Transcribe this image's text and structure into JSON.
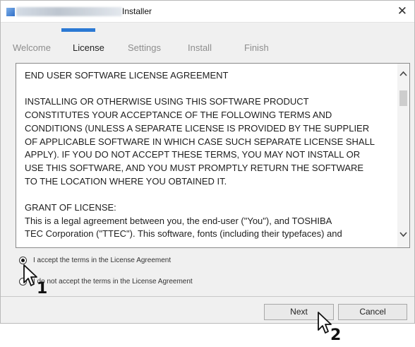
{
  "window": {
    "title": "Installer",
    "close_glyph": "✕"
  },
  "tabs": [
    {
      "label": "Welcome",
      "active": false
    },
    {
      "label": "License",
      "active": true
    },
    {
      "label": "Settings",
      "active": false
    },
    {
      "label": "Install",
      "active": false
    },
    {
      "label": "Finish",
      "active": false
    }
  ],
  "license": {
    "heading": "END USER SOFTWARE LICENSE AGREEMENT",
    "paragraph1": "INSTALLING OR OTHERWISE USING THIS SOFTWARE PRODUCT\nCONSTITUTES YOUR ACCEPTANCE OF THE FOLLOWING TERMS AND\nCONDITIONS (UNLESS A SEPARATE LICENSE IS PROVIDED BY THE SUPPLIER\nOF APPLICABLE SOFTWARE IN WHICH CASE SUCH SEPARATE LICENSE SHALL\nAPPLY). IF YOU DO NOT ACCEPT THESE TERMS, YOU MAY NOT INSTALL OR\nUSE THIS SOFTWARE, AND YOU MUST PROMPTLY RETURN THE SOFTWARE\nTO THE LOCATION WHERE YOU OBTAINED IT.",
    "grant_heading": "GRANT OF LICENSE:",
    "grant_text": "This is a legal agreement between you, the end-user (\"You\"), and TOSHIBA\nTEC Corporation (\"TTEC\"). This software, fonts (including their typefaces) and"
  },
  "options": {
    "accept_label": "I accept the terms in the License Agreement",
    "decline_label": "I do not accept the terms in the License Agreement",
    "selected": "accept"
  },
  "buttons": {
    "next_label": "Next",
    "cancel_label": "Cancel"
  },
  "annotations": {
    "step1": "1",
    "step2": "2"
  }
}
